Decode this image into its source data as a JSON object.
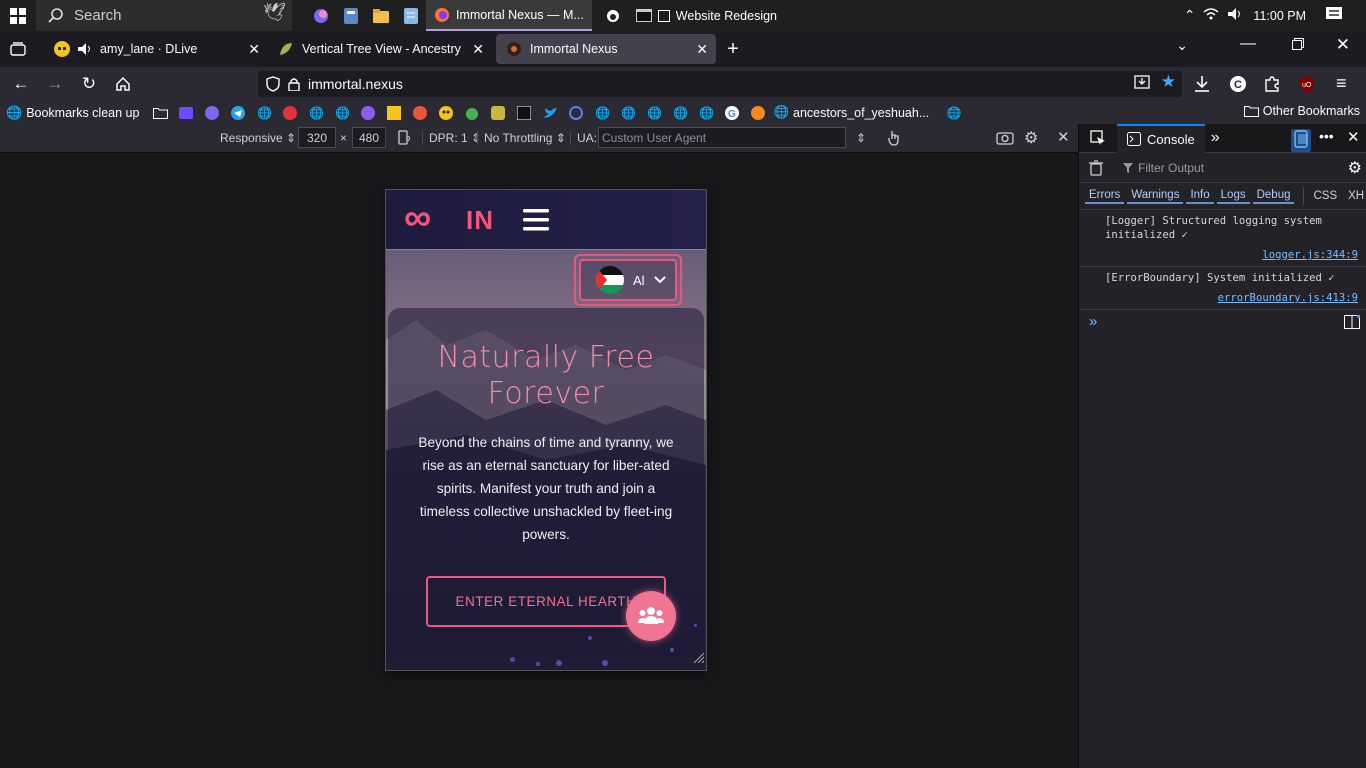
{
  "taskbar": {
    "search_placeholder": "Search",
    "tasks": [
      {
        "label": "Immortal Nexus — M...",
        "active": true
      },
      {
        "label": "Website Redesign",
        "active": false
      }
    ],
    "clock": "11:00 PM"
  },
  "tabs": [
    {
      "label": "amy_lane · DLive"
    },
    {
      "label": "Vertical Tree View - Ancestry"
    },
    {
      "label": "Immortal Nexus"
    }
  ],
  "navbar": {
    "url": "immortal.nexus"
  },
  "bookmarks": {
    "first": "Bookmarks clean up",
    "named": "ancestors_of_yeshuah...",
    "other": "Other Bookmarks"
  },
  "rdm": {
    "device": "Responsive",
    "width": "320",
    "times": "×",
    "height": "480",
    "dpr": "DPR: 1",
    "throttling": "No Throttling",
    "ua_label": "UA:",
    "ua_placeholder": "Custom User Agent"
  },
  "site": {
    "logo_symbol": "∞",
    "logo_text": "IN",
    "lang_code": "Al",
    "hero_title": "Naturally Free Forever",
    "hero_text": "Beyond the chains of time and tyranny, we rise as an eternal sanctuary for liber-ated spirits. Manifest your truth and join a timeless collective unshackled by fleet-ing powers.",
    "cta": "ENTER ETERNAL HEARTH"
  },
  "devtools": {
    "tab": "Console",
    "filter_placeholder": "Filter Output",
    "levels": [
      "Errors",
      "Warnings",
      "Info",
      "Logs",
      "Debug"
    ],
    "extra_levels": [
      "CSS",
      "XH"
    ],
    "messages": [
      {
        "text": "[Logger] Structured logging system initialized ✓",
        "source": "logger.js:344:9"
      },
      {
        "text": "[ErrorBoundary] System initialized ✓",
        "source": "errorBoundary.js:413:9"
      }
    ]
  },
  "colors": {
    "accent_pink": "#f0577e",
    "header_bg": "#1e1b3d",
    "browser_chrome": "#2b2a33"
  }
}
